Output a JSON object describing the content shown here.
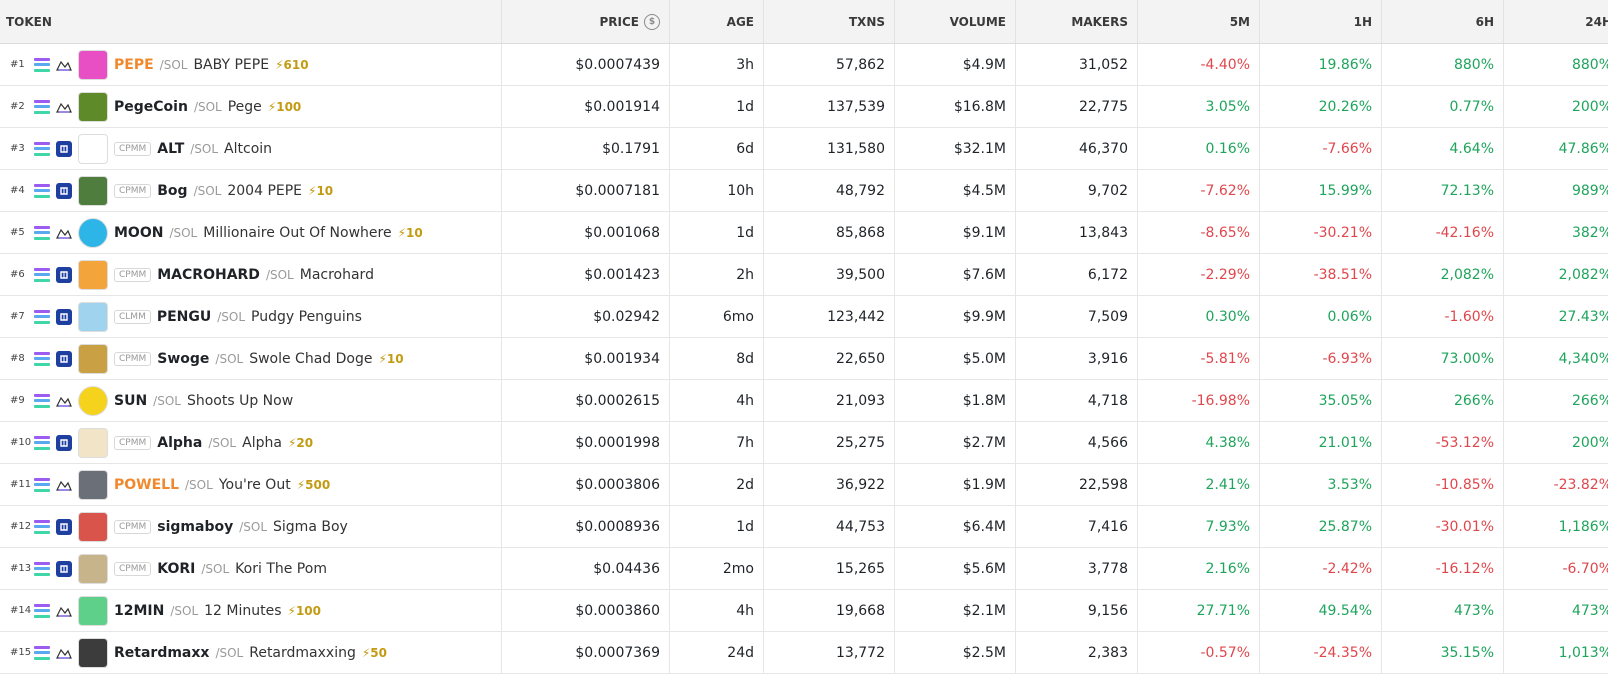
{
  "columns": {
    "token": "TOKEN",
    "price": "PRICE",
    "age": "AGE",
    "txns": "TXNS",
    "volume": "VOLUME",
    "makers": "MAKERS",
    "m5": "5M",
    "h1": "1H",
    "h6": "6H",
    "h24": "24H"
  },
  "rows": [
    {
      "rank": "#1",
      "sym": "PEPE",
      "hot": true,
      "pair": "/SOL",
      "name": "BABY PEPE",
      "boost": "⚡610",
      "tag": "",
      "dex": "raydium",
      "price": "$0.0007439",
      "age": "3h",
      "txns": "57,862",
      "volume": "$4.9M",
      "makers": "31,052",
      "m5": "-4.40%",
      "h1": "19.86%",
      "h6": "880%",
      "h24": "880%",
      "avatar": "#e94fc4"
    },
    {
      "rank": "#2",
      "sym": "PegeCoin",
      "hot": false,
      "pair": "/SOL",
      "name": "Pege",
      "boost": "⚡100",
      "tag": "",
      "dex": "raydium",
      "price": "$0.001914",
      "age": "1d",
      "txns": "137,539",
      "volume": "$16.8M",
      "makers": "22,775",
      "m5": "3.05%",
      "h1": "20.26%",
      "h6": "0.77%",
      "h24": "200%",
      "avatar": "#5e8a2a"
    },
    {
      "rank": "#3",
      "sym": "ALT",
      "hot": false,
      "pair": "/SOL",
      "name": "Altcoin",
      "boost": "",
      "tag": "CPMM",
      "dex": "blue",
      "price": "$0.1791",
      "age": "6d",
      "txns": "131,580",
      "volume": "$32.1M",
      "makers": "46,370",
      "m5": "0.16%",
      "h1": "-7.66%",
      "h6": "4.64%",
      "h24": "47.86%",
      "avatar": "#ffffff"
    },
    {
      "rank": "#4",
      "sym": "Bog",
      "hot": false,
      "pair": "/SOL",
      "name": "2004 PEPE",
      "boost": "⚡10",
      "tag": "CPMM",
      "dex": "blue",
      "price": "$0.0007181",
      "age": "10h",
      "txns": "48,792",
      "volume": "$4.5M",
      "makers": "9,702",
      "m5": "-7.62%",
      "h1": "15.99%",
      "h6": "72.13%",
      "h24": "989%",
      "avatar": "#4f7d3e"
    },
    {
      "rank": "#5",
      "sym": "MOON",
      "hot": false,
      "pair": "/SOL",
      "name": "Millionaire Out Of Nowhere",
      "boost": "⚡10",
      "tag": "",
      "dex": "raydium",
      "price": "$0.001068",
      "age": "1d",
      "txns": "85,868",
      "volume": "$9.1M",
      "makers": "13,843",
      "m5": "-8.65%",
      "h1": "-30.21%",
      "h6": "-42.16%",
      "h24": "382%",
      "avatar": "#2eb5e8"
    },
    {
      "rank": "#6",
      "sym": "MACROHARD",
      "hot": false,
      "pair": "/SOL",
      "name": "Macrohard",
      "boost": "",
      "tag": "CPMM",
      "dex": "blue",
      "price": "$0.001423",
      "age": "2h",
      "txns": "39,500",
      "volume": "$7.6M",
      "makers": "6,172",
      "m5": "-2.29%",
      "h1": "-38.51%",
      "h6": "2,082%",
      "h24": "2,082%",
      "avatar": "#f3a43b"
    },
    {
      "rank": "#7",
      "sym": "PENGU",
      "hot": false,
      "pair": "/SOL",
      "name": "Pudgy Penguins",
      "boost": "",
      "tag": "CLMM",
      "dex": "blue",
      "price": "$0.02942",
      "age": "6mo",
      "txns": "123,442",
      "volume": "$9.9M",
      "makers": "7,509",
      "m5": "0.30%",
      "h1": "0.06%",
      "h6": "-1.60%",
      "h24": "27.43%",
      "avatar": "#9fd3ee"
    },
    {
      "rank": "#8",
      "sym": "Swoge",
      "hot": false,
      "pair": "/SOL",
      "name": "Swole Chad Doge",
      "boost": "⚡10",
      "tag": "CPMM",
      "dex": "blue",
      "price": "$0.001934",
      "age": "8d",
      "txns": "22,650",
      "volume": "$5.0M",
      "makers": "3,916",
      "m5": "-5.81%",
      "h1": "-6.93%",
      "h6": "73.00%",
      "h24": "4,340%",
      "avatar": "#c9a144"
    },
    {
      "rank": "#9",
      "sym": "SUN",
      "hot": false,
      "pair": "/SOL",
      "name": "Shoots Up Now",
      "boost": "",
      "tag": "",
      "dex": "raydium",
      "price": "$0.0002615",
      "age": "4h",
      "txns": "21,093",
      "volume": "$1.8M",
      "makers": "4,718",
      "m5": "-16.98%",
      "h1": "35.05%",
      "h6": "266%",
      "h24": "266%",
      "avatar": "#f5d21b"
    },
    {
      "rank": "#10",
      "sym": "Alpha",
      "hot": false,
      "pair": "/SOL",
      "name": "Alpha",
      "boost": "⚡20",
      "tag": "CPMM",
      "dex": "blue",
      "price": "$0.0001998",
      "age": "7h",
      "txns": "25,275",
      "volume": "$2.7M",
      "makers": "4,566",
      "m5": "4.38%",
      "h1": "21.01%",
      "h6": "-53.12%",
      "h24": "200%",
      "avatar": "#f2e5c7"
    },
    {
      "rank": "#11",
      "sym": "POWELL",
      "hot": true,
      "pair": "/SOL",
      "name": "You're Out",
      "boost": "⚡500",
      "tag": "",
      "dex": "raydium",
      "price": "$0.0003806",
      "age": "2d",
      "txns": "36,922",
      "volume": "$1.9M",
      "makers": "22,598",
      "m5": "2.41%",
      "h1": "3.53%",
      "h6": "-10.85%",
      "h24": "-23.82%",
      "avatar": "#6b6f78"
    },
    {
      "rank": "#12",
      "sym": "sigmaboy",
      "hot": false,
      "pair": "/SOL",
      "name": "Sigma Boy",
      "boost": "",
      "tag": "CPMM",
      "dex": "blue",
      "price": "$0.0008936",
      "age": "1d",
      "txns": "44,753",
      "volume": "$6.4M",
      "makers": "7,416",
      "m5": "7.93%",
      "h1": "25.87%",
      "h6": "-30.01%",
      "h24": "1,186%",
      "avatar": "#d9544a"
    },
    {
      "rank": "#13",
      "sym": "KORI",
      "hot": false,
      "pair": "/SOL",
      "name": "Kori The Pom",
      "boost": "",
      "tag": "CPMM",
      "dex": "blue",
      "price": "$0.04436",
      "age": "2mo",
      "txns": "15,265",
      "volume": "$5.6M",
      "makers": "3,778",
      "m5": "2.16%",
      "h1": "-2.42%",
      "h6": "-16.12%",
      "h24": "-6.70%",
      "avatar": "#c8b48a"
    },
    {
      "rank": "#14",
      "sym": "12MIN",
      "hot": false,
      "pair": "/SOL",
      "name": "12 Minutes",
      "boost": "⚡100",
      "tag": "",
      "dex": "raydium",
      "price": "$0.0003860",
      "age": "4h",
      "txns": "19,668",
      "volume": "$2.1M",
      "makers": "9,156",
      "m5": "27.71%",
      "h1": "49.54%",
      "h6": "473%",
      "h24": "473%",
      "avatar": "#5fd08a"
    },
    {
      "rank": "#15",
      "sym": "Retardmaxx",
      "hot": false,
      "pair": "/SOL",
      "name": "Retardmaxxing",
      "boost": "⚡50",
      "tag": "",
      "dex": "raydium",
      "price": "$0.0007369",
      "age": "24d",
      "txns": "13,772",
      "volume": "$2.5M",
      "makers": "2,383",
      "m5": "-0.57%",
      "h1": "-24.35%",
      "h6": "35.15%",
      "h24": "1,013%",
      "avatar": "#3c3c3c"
    }
  ]
}
